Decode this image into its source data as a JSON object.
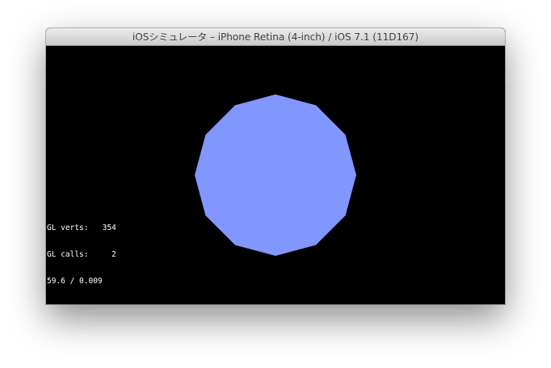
{
  "window": {
    "title": "iOSシミュレータ – iPhone Retina (4-inch) / iOS 7.1 (11D167)"
  },
  "scene": {
    "background_color": "#000000",
    "shape": "dodecagon",
    "fill_color": "#8296FF"
  },
  "stats": {
    "verts_label": "GL verts:",
    "verts_value": "354",
    "calls_label": "GL calls:",
    "calls_value": "2",
    "fps_line": "59.6 / 0.009"
  }
}
